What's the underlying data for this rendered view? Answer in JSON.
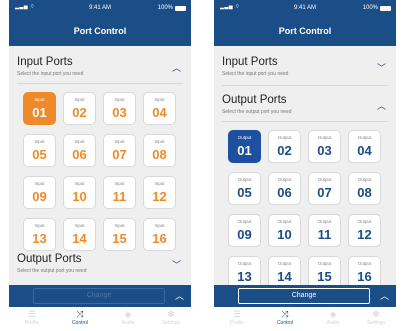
{
  "status": {
    "signal": "▂▃▅ ⌔",
    "time": "9:41 AM",
    "battery": "100%"
  },
  "nav_title": "Port Control",
  "input_section": {
    "title": "Input Ports",
    "subtitle": "Select the input port you need"
  },
  "output_section": {
    "title": "Output Ports",
    "subtitle": "Select the output port you need"
  },
  "input_label": "Input",
  "output_label": "Output",
  "ports": [
    "01",
    "02",
    "03",
    "04",
    "05",
    "06",
    "07",
    "08",
    "09",
    "10",
    "11",
    "12",
    "13",
    "14",
    "15",
    "16"
  ],
  "left_screen": {
    "selected_input": "01",
    "change_label": "Change",
    "change_enabled": false
  },
  "right_screen": {
    "selected_output": "01",
    "change_label": "Change",
    "change_enabled": true
  },
  "tabs": [
    {
      "label": "Profile",
      "icon": "list-icon"
    },
    {
      "label": "Control",
      "icon": "shuffle-icon",
      "active": true
    },
    {
      "label": "Audio",
      "icon": "speaker-icon"
    },
    {
      "label": "Settings",
      "icon": "gear-icon"
    }
  ],
  "colors": {
    "brand_blue": "#1b4d86",
    "input_orange": "#ef8a2b",
    "output_selected": "#1f4fa0",
    "background": "#efefef"
  }
}
